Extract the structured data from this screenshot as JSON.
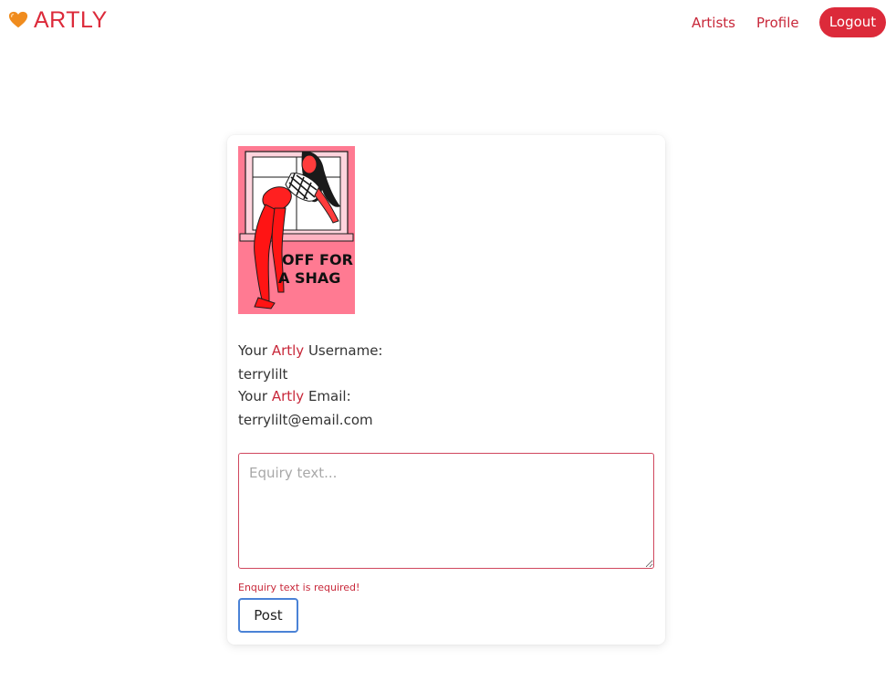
{
  "header": {
    "brand_name": "ARTLY",
    "brand_icon": "orange-heart-icon",
    "nav": {
      "artists": "Artists",
      "profile": "Profile",
      "logout": "Logout"
    }
  },
  "card": {
    "artwork_text_line1": "OFF FOR",
    "artwork_text_line2": "A SHAG",
    "username_label_prefix": "Your",
    "username_label_accent": "Artly",
    "username_label_suffix": "Username:",
    "username_value": "terrylilt",
    "email_label_prefix": "Your",
    "email_label_accent": "Artly",
    "email_label_suffix": "Email:",
    "email_value": "terrylilt@email.com",
    "enquiry_placeholder": "Equiry text...",
    "enquiry_value": "",
    "error_message": "Enquiry text is required!",
    "post_label": "Post"
  },
  "colors": {
    "accent": "#dc2a3a",
    "link": "#c8283a",
    "artwork_bg": "#ff7a92",
    "focus_border": "#4a82d6"
  }
}
